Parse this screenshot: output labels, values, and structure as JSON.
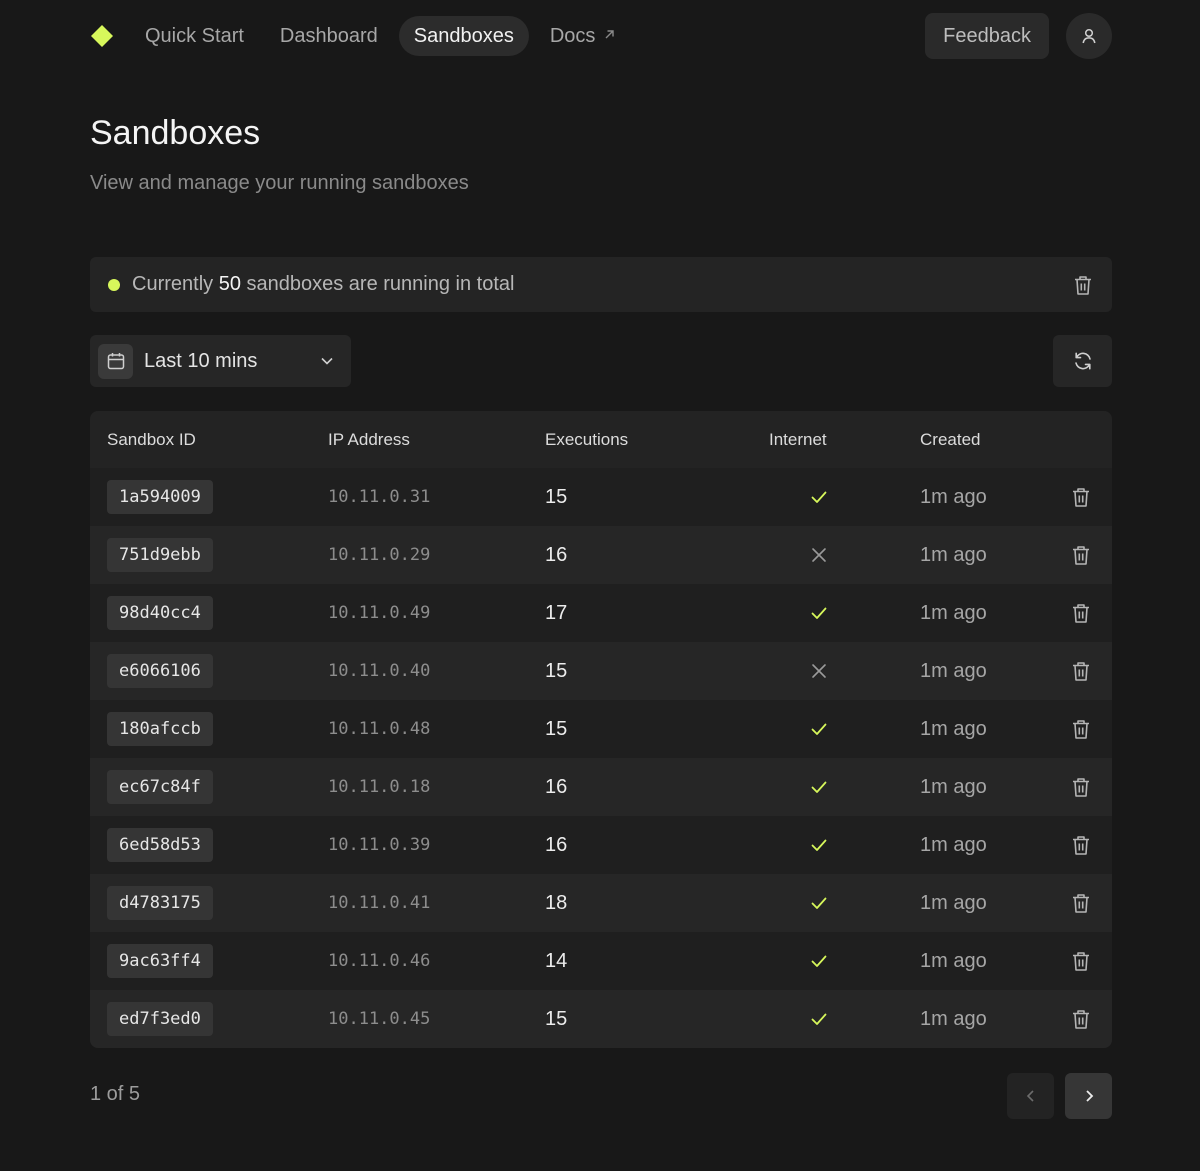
{
  "nav": {
    "links": [
      {
        "label": "Quick Start"
      },
      {
        "label": "Dashboard"
      },
      {
        "label": "Sandboxes",
        "active": true
      },
      {
        "label": "Docs",
        "external": true
      }
    ],
    "feedback_label": "Feedback",
    "accent_color": "#d7f75b"
  },
  "header": {
    "title": "Sandboxes",
    "subtitle": "View and manage your running sandboxes"
  },
  "banner": {
    "prefix": "Currently ",
    "count": "50",
    "suffix": " sandboxes are running in total"
  },
  "filters": {
    "time_range": "Last 10 mins"
  },
  "table": {
    "columns": [
      "Sandbox ID",
      "IP Address",
      "Executions",
      "Internet",
      "Created"
    ],
    "rows": [
      {
        "id": "1a594009",
        "ip": "10.11.0.31",
        "executions": "15",
        "internet": true,
        "created": "1m ago"
      },
      {
        "id": "751d9ebb",
        "ip": "10.11.0.29",
        "executions": "16",
        "internet": false,
        "created": "1m ago"
      },
      {
        "id": "98d40cc4",
        "ip": "10.11.0.49",
        "executions": "17",
        "internet": true,
        "created": "1m ago"
      },
      {
        "id": "e6066106",
        "ip": "10.11.0.40",
        "executions": "15",
        "internet": false,
        "created": "1m ago"
      },
      {
        "id": "180afccb",
        "ip": "10.11.0.48",
        "executions": "15",
        "internet": true,
        "created": "1m ago"
      },
      {
        "id": "ec67c84f",
        "ip": "10.11.0.18",
        "executions": "16",
        "internet": true,
        "created": "1m ago"
      },
      {
        "id": "6ed58d53",
        "ip": "10.11.0.39",
        "executions": "16",
        "internet": true,
        "created": "1m ago"
      },
      {
        "id": "d4783175",
        "ip": "10.11.0.41",
        "executions": "18",
        "internet": true,
        "created": "1m ago"
      },
      {
        "id": "9ac63ff4",
        "ip": "10.11.0.46",
        "executions": "14",
        "internet": true,
        "created": "1m ago"
      },
      {
        "id": "ed7f3ed0",
        "ip": "10.11.0.45",
        "executions": "15",
        "internet": true,
        "created": "1m ago"
      }
    ]
  },
  "pagination": {
    "label": "1 of 5"
  }
}
